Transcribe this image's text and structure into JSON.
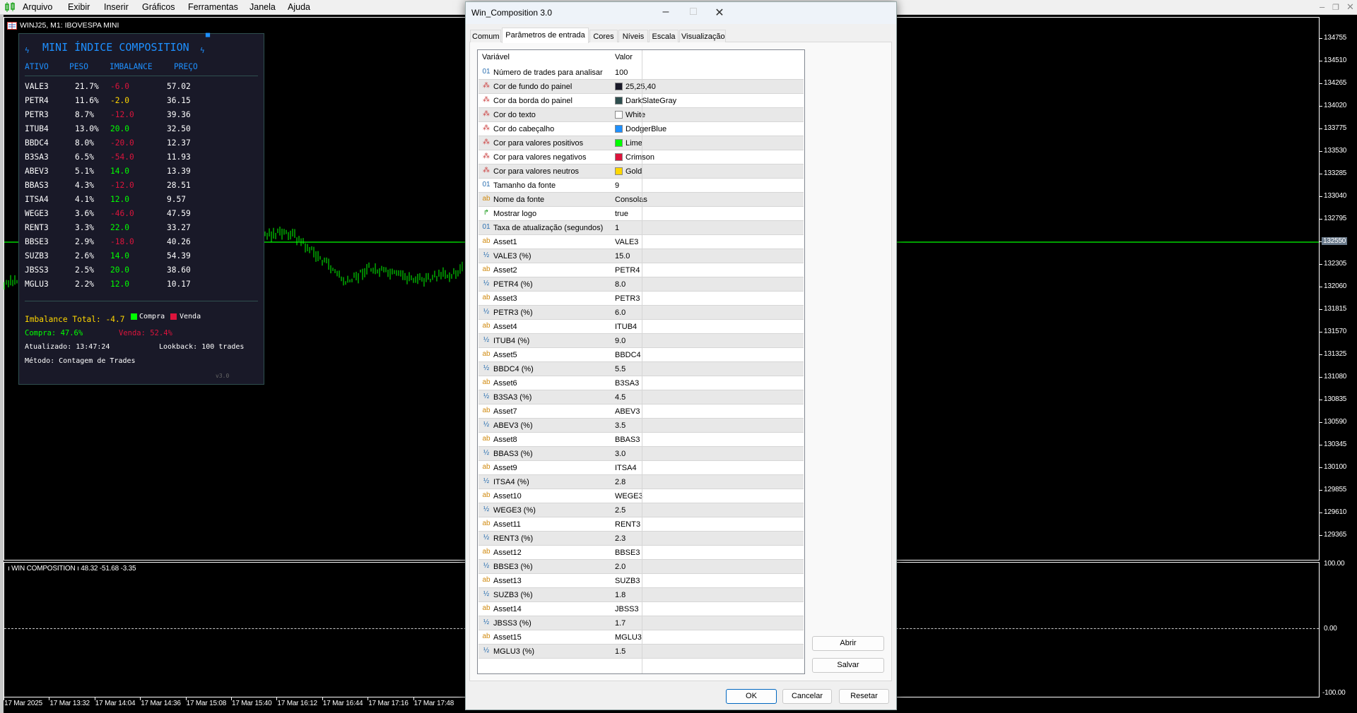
{
  "menubar": {
    "items": [
      "Arquivo",
      "Exibir",
      "Inserir",
      "Gráficos",
      "Ferramentas",
      "Janela",
      "Ajuda"
    ]
  },
  "chart": {
    "title": "WINJ25, M1: IBOVESPA MINI",
    "price_axis": [
      "134755",
      "134510",
      "134265",
      "134020",
      "133775",
      "133530",
      "133285",
      "133040",
      "132795",
      "132550",
      "132305",
      "132060",
      "131815",
      "131570",
      "131325",
      "131080",
      "130835",
      "130590",
      "130345",
      "130100",
      "129855",
      "129610",
      "129365"
    ],
    "current_price": "132550",
    "time_axis": [
      "17 Mar 2025",
      "17 Mar 13:32",
      "17 Mar 14:04",
      "17 Mar 14:36",
      "17 Mar 15:08",
      "17 Mar 15:40",
      "17 Mar 16:12",
      "17 Mar 16:44",
      "17 Mar 17:16",
      "17 Mar 17:48"
    ],
    "bar_color": "#00ff00"
  },
  "indicator": {
    "label": "WIN COMPOSITION",
    "values": "48.32 -51.68 -3.35",
    "axis": [
      "100.00",
      "0.00",
      "-100.00"
    ]
  },
  "panel": {
    "title": "MINI ÍNDICE COMPOSITION",
    "headers": {
      "asset": "ATIVO",
      "weight": "PESO",
      "imbalance": "IMBALANCE",
      "price": "PREÇO"
    },
    "colors": {
      "background": "#191928",
      "border": "#2f4f4f",
      "text": "#ffffff",
      "header": "#1e90ff",
      "positive": "#00ff00",
      "negative": "#dc143c",
      "neutral": "#ffd700"
    },
    "rows": [
      {
        "asset": "VALE3",
        "weight": "21.7%",
        "imbalance": "-6.0",
        "state": "negative",
        "price": "57.02"
      },
      {
        "asset": "PETR4",
        "weight": "11.6%",
        "imbalance": "-2.0",
        "state": "neutral",
        "price": "36.15"
      },
      {
        "asset": "PETR3",
        "weight": "8.7%",
        "imbalance": "-12.0",
        "state": "negative",
        "price": "39.36"
      },
      {
        "asset": "ITUB4",
        "weight": "13.0%",
        "imbalance": "20.0",
        "state": "positive",
        "price": "32.50"
      },
      {
        "asset": "BBDC4",
        "weight": "8.0%",
        "imbalance": "-20.0",
        "state": "negative",
        "price": "12.37"
      },
      {
        "asset": "B3SA3",
        "weight": "6.5%",
        "imbalance": "-54.0",
        "state": "negative",
        "price": "11.93"
      },
      {
        "asset": "ABEV3",
        "weight": "5.1%",
        "imbalance": "14.0",
        "state": "positive",
        "price": "13.39"
      },
      {
        "asset": "BBAS3",
        "weight": "4.3%",
        "imbalance": "-12.0",
        "state": "negative",
        "price": "28.51"
      },
      {
        "asset": "ITSA4",
        "weight": "4.1%",
        "imbalance": "12.0",
        "state": "positive",
        "price": "9.57"
      },
      {
        "asset": "WEGE3",
        "weight": "3.6%",
        "imbalance": "-46.0",
        "state": "negative",
        "price": "47.59"
      },
      {
        "asset": "RENT3",
        "weight": "3.3%",
        "imbalance": "22.0",
        "state": "positive",
        "price": "33.27"
      },
      {
        "asset": "BBSE3",
        "weight": "2.9%",
        "imbalance": "-18.0",
        "state": "negative",
        "price": "40.26"
      },
      {
        "asset": "SUZB3",
        "weight": "2.6%",
        "imbalance": "14.0",
        "state": "positive",
        "price": "54.39"
      },
      {
        "asset": "JBSS3",
        "weight": "2.5%",
        "imbalance": "20.0",
        "state": "positive",
        "price": "38.60"
      },
      {
        "asset": "MGLU3",
        "weight": "2.2%",
        "imbalance": "12.0",
        "state": "positive",
        "price": "10.17"
      }
    ],
    "total": "Imbalance Total: -4.7",
    "legend_buy": "Compra",
    "legend_sell": "Venda",
    "buy_pct": "Compra: 47.6%",
    "sell_pct": "Venda: 52.4%",
    "updated": "Atualizado: 13:47:24",
    "lookback": "Lookback: 100 trades",
    "method": "Método: Contagem de Trades",
    "version": "v3.0"
  },
  "dialog": {
    "title": "Win_Composition 3.0",
    "tabs": [
      "Comum",
      "Parâmetros de entrada",
      "Cores",
      "Níveis",
      "Escala",
      "Visualização"
    ],
    "active_tab": "Parâmetros de entrada",
    "columns": [
      "Variável",
      "Valor"
    ],
    "params": [
      {
        "type": "int",
        "name": "Número de trades para analisar",
        "value": "100"
      },
      {
        "type": "color",
        "name": "Cor de fundo do painel",
        "value": "25,25,40",
        "swatch": "#191928"
      },
      {
        "type": "color",
        "name": "Cor da borda do painel",
        "value": "DarkSlateGray",
        "swatch": "#2f4f4f"
      },
      {
        "type": "color",
        "name": "Cor do texto",
        "value": "White",
        "swatch": "#ffffff"
      },
      {
        "type": "color",
        "name": "Cor do cabeçalho",
        "value": "DodgerBlue",
        "swatch": "#1e90ff"
      },
      {
        "type": "color",
        "name": "Cor para valores positivos",
        "value": "Lime",
        "swatch": "#00ff00"
      },
      {
        "type": "color",
        "name": "Cor para valores negativos",
        "value": "Crimson",
        "swatch": "#dc143c"
      },
      {
        "type": "color",
        "name": "Cor para valores neutros",
        "value": "Gold",
        "swatch": "#ffd700"
      },
      {
        "type": "int",
        "name": "Tamanho da fonte",
        "value": "9"
      },
      {
        "type": "string",
        "name": "Nome da fonte",
        "value": "Consolas"
      },
      {
        "type": "bool",
        "name": "Mostrar logo",
        "value": "true"
      },
      {
        "type": "int",
        "name": "Taxa de atualização (segundos)",
        "value": "1"
      },
      {
        "type": "string",
        "name": "Asset1",
        "value": "VALE3"
      },
      {
        "type": "double",
        "name": "VALE3 (%)",
        "value": "15.0"
      },
      {
        "type": "string",
        "name": "Asset2",
        "value": "PETR4"
      },
      {
        "type": "double",
        "name": "PETR4 (%)",
        "value": "8.0"
      },
      {
        "type": "string",
        "name": "Asset3",
        "value": "PETR3"
      },
      {
        "type": "double",
        "name": "PETR3 (%)",
        "value": "6.0"
      },
      {
        "type": "string",
        "name": "Asset4",
        "value": "ITUB4"
      },
      {
        "type": "double",
        "name": "ITUB4 (%)",
        "value": "9.0"
      },
      {
        "type": "string",
        "name": "Asset5",
        "value": "BBDC4"
      },
      {
        "type": "double",
        "name": "BBDC4 (%)",
        "value": "5.5"
      },
      {
        "type": "string",
        "name": "Asset6",
        "value": "B3SA3"
      },
      {
        "type": "double",
        "name": "B3SA3 (%)",
        "value": "4.5"
      },
      {
        "type": "string",
        "name": "Asset7",
        "value": "ABEV3"
      },
      {
        "type": "double",
        "name": "ABEV3 (%)",
        "value": "3.5"
      },
      {
        "type": "string",
        "name": "Asset8",
        "value": "BBAS3"
      },
      {
        "type": "double",
        "name": "BBAS3 (%)",
        "value": "3.0"
      },
      {
        "type": "string",
        "name": "Asset9",
        "value": "ITSA4"
      },
      {
        "type": "double",
        "name": "ITSA4 (%)",
        "value": "2.8"
      },
      {
        "type": "string",
        "name": "Asset10",
        "value": "WEGE3"
      },
      {
        "type": "double",
        "name": "WEGE3 (%)",
        "value": "2.5"
      },
      {
        "type": "string",
        "name": "Asset11",
        "value": "RENT3"
      },
      {
        "type": "double",
        "name": "RENT3 (%)",
        "value": "2.3"
      },
      {
        "type": "string",
        "name": "Asset12",
        "value": "BBSE3"
      },
      {
        "type": "double",
        "name": "BBSE3 (%)",
        "value": "2.0"
      },
      {
        "type": "string",
        "name": "Asset13",
        "value": "SUZB3"
      },
      {
        "type": "double",
        "name": "SUZB3 (%)",
        "value": "1.8"
      },
      {
        "type": "string",
        "name": "Asset14",
        "value": "JBSS3"
      },
      {
        "type": "double",
        "name": "JBSS3 (%)",
        "value": "1.7"
      },
      {
        "type": "string",
        "name": "Asset15",
        "value": "MGLU3"
      },
      {
        "type": "double",
        "name": "MGLU3 (%)",
        "value": "1.5"
      }
    ],
    "buttons": {
      "open": "Abrir",
      "save": "Salvar",
      "ok": "OK",
      "cancel": "Cancelar",
      "reset": "Resetar"
    }
  }
}
